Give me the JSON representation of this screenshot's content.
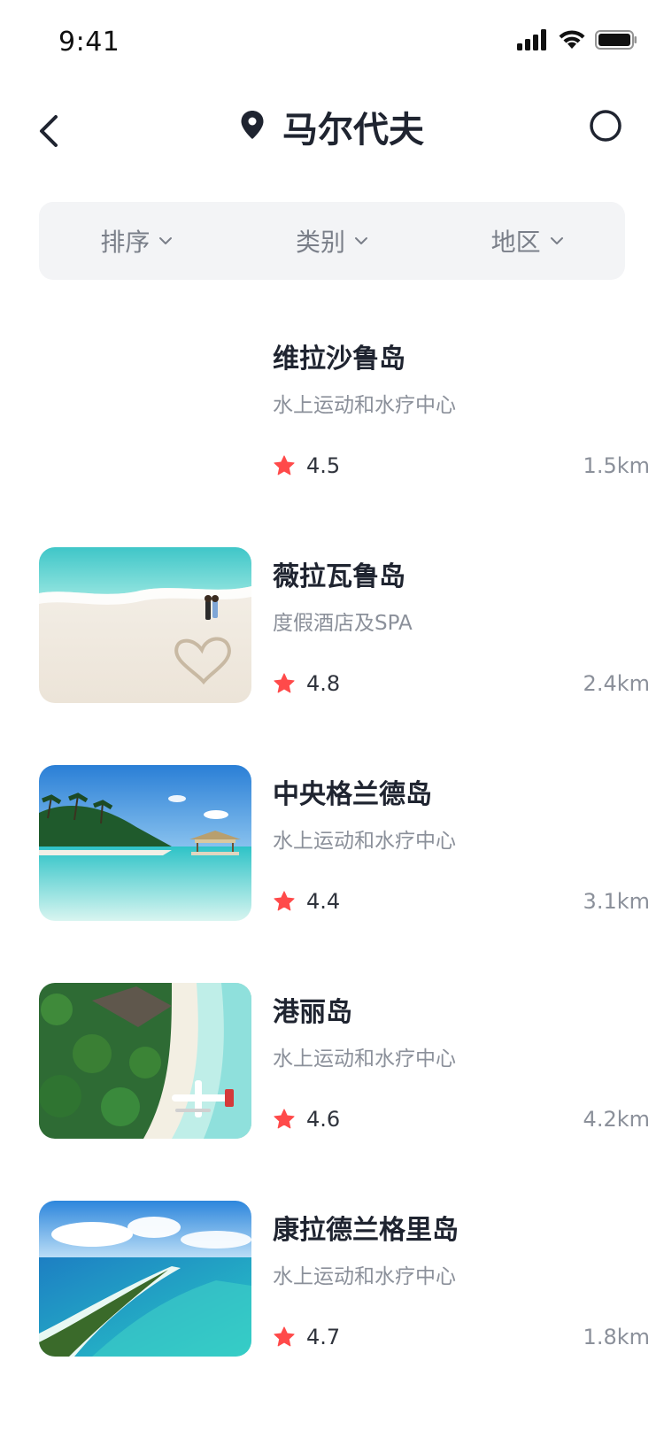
{
  "status_bar": {
    "time": "9:41"
  },
  "header": {
    "title": "马尔代夫"
  },
  "filters": [
    {
      "label": "排序"
    },
    {
      "label": "类别"
    },
    {
      "label": "地区"
    }
  ],
  "items": [
    {
      "name": "维拉沙鲁岛",
      "desc": "水上运动和水疗中心",
      "rating": "4.5",
      "distance": "1.5km"
    },
    {
      "name": "薇拉瓦鲁岛",
      "desc": "度假酒店及SPA",
      "rating": "4.8",
      "distance": "2.4km"
    },
    {
      "name": "中央格兰德岛",
      "desc": "水上运动和水疗中心",
      "rating": "4.4",
      "distance": "3.1km"
    },
    {
      "name": "港丽岛",
      "desc": "水上运动和水疗中心",
      "rating": "4.6",
      "distance": "4.2km"
    },
    {
      "name": "康拉德兰格里岛",
      "desc": "水上运动和水疗中心",
      "rating": "4.7",
      "distance": "1.8km"
    }
  ],
  "colors": {
    "star": "#ff4a4a",
    "accent_text": "#1f2430",
    "muted_text": "#8b909a",
    "filter_bg": "#f3f4f6"
  }
}
